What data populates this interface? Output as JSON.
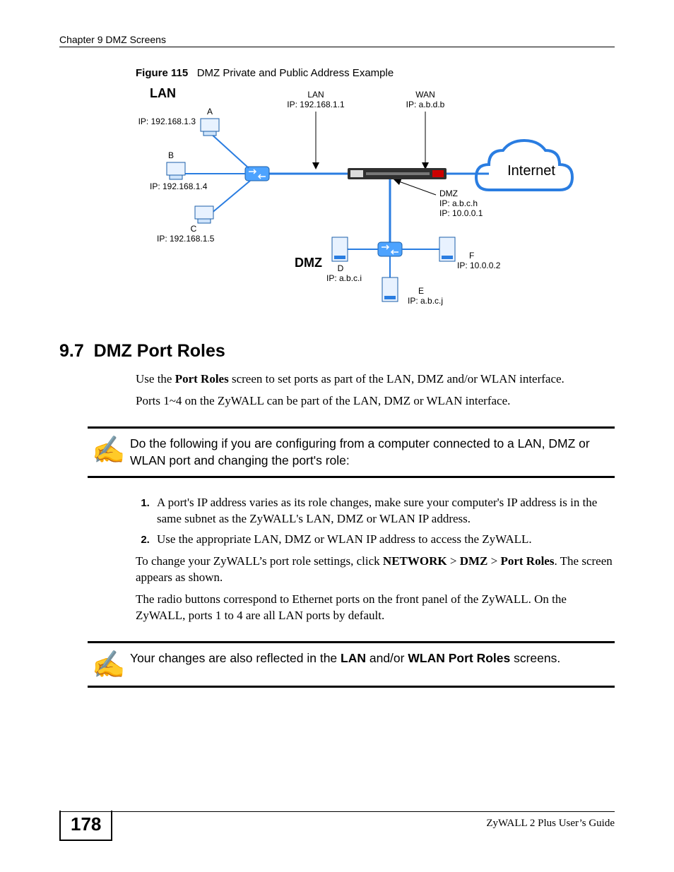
{
  "chapterHeader": "Chapter 9 DMZ Screens",
  "figure": {
    "label": "Figure 115",
    "title": "DMZ Private and Public Address Example"
  },
  "diagram": {
    "lanHead": "LAN",
    "dmzHead": "DMZ",
    "internet": "Internet",
    "nodes": {
      "a": {
        "name": "A",
        "ip": "IP: 192.168.1.3"
      },
      "b": {
        "name": "B",
        "ip": "IP: 192.168.1.4"
      },
      "c": {
        "name": "C",
        "ip": "IP: 192.168.1.5"
      },
      "d": {
        "name": "D",
        "ip": "IP: a.b.c.i"
      },
      "e": {
        "name": "E",
        "ip": "IP: a.b.c.j"
      },
      "f": {
        "name": "F",
        "ip": "IP: 10.0.0.2"
      },
      "lan": {
        "name": "LAN",
        "ip": "IP: 192.168.1.1"
      },
      "wan": {
        "name": "WAN",
        "ip": "IP: a.b.d.b"
      },
      "dmz": {
        "name": "DMZ",
        "ip1": "IP: a.b.c.h",
        "ip2": "IP: 10.0.0.1"
      }
    }
  },
  "section": {
    "number": "9.7",
    "title": "DMZ Port Roles"
  },
  "para1_a": "Use the ",
  "para1_b": "Port Roles",
  "para1_c": " screen to set ports as part of the LAN, DMZ and/or WLAN interface.",
  "para2": "Ports 1~4 on the ZyWALL can be part of the LAN, DMZ or WLAN interface.",
  "note1": "Do the following if you are configuring from a computer connected to a LAN, DMZ or WLAN port and changing the port's role:",
  "list": {
    "item1": "A port's IP address varies as its role changes, make sure your computer's IP address is in the same subnet as the ZyWALL's LAN, DMZ or WLAN IP address.",
    "item2": "Use the appropriate LAN, DMZ or WLAN IP address to access the ZyWALL."
  },
  "para3_a": "To change your ZyWALL’s port role settings, click ",
  "para3_b": "NETWORK",
  "para3_c": " > ",
  "para3_d": "DMZ",
  "para3_e": " > ",
  "para3_f": "Port Roles",
  "para3_g": ". The screen appears as shown.",
  "para4": "The radio buttons correspond to Ethernet ports on the front panel of the ZyWALL. On the ZyWALL, ports 1 to 4 are all LAN ports by default.",
  "note2_a": "Your changes are also reflected in the ",
  "note2_b": "LAN",
  "note2_c": " and/or ",
  "note2_d": "WLAN Port Roles",
  "note2_e": " screens.",
  "footer": {
    "page": "178",
    "guide": "ZyWALL 2 Plus User’s Guide"
  }
}
